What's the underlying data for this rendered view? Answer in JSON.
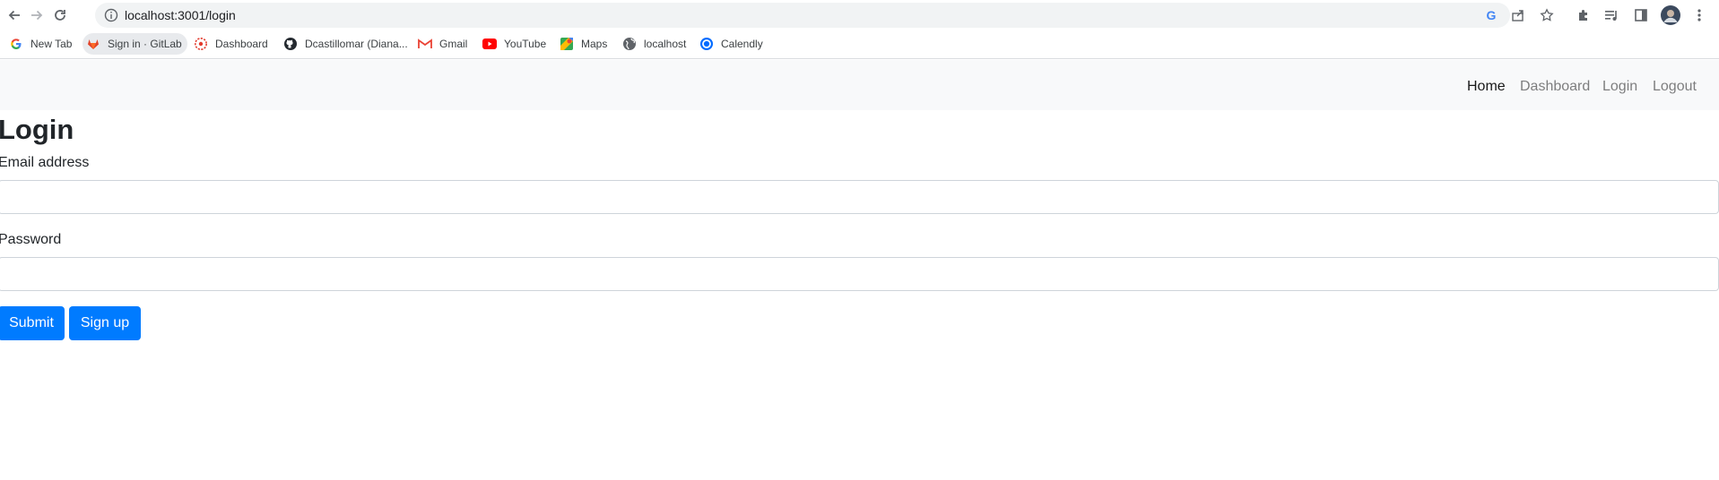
{
  "browser": {
    "url": "localhost:3001/login",
    "bookmarks": [
      {
        "label": "New Tab",
        "icon": "google-icon"
      },
      {
        "label": "Sign in · GitLab",
        "icon": "gitlab-icon"
      },
      {
        "label": "Dashboard",
        "icon": "dashboard-icon"
      },
      {
        "label": "Dcastillomar (Diana...",
        "icon": "github-icon"
      },
      {
        "label": "Gmail",
        "icon": "gmail-icon"
      },
      {
        "label": "YouTube",
        "icon": "youtube-icon"
      },
      {
        "label": "Maps",
        "icon": "maps-icon"
      },
      {
        "label": "localhost",
        "icon": "globe-icon"
      },
      {
        "label": "Calendly",
        "icon": "calendly-icon"
      }
    ]
  },
  "navbar": {
    "links": [
      {
        "label": "Home",
        "active": true
      },
      {
        "label": "Dashboard",
        "active": false
      },
      {
        "label": "Login",
        "active": false
      },
      {
        "label": "Logout",
        "active": false
      }
    ]
  },
  "form": {
    "title": "Login",
    "email_label": "Email address",
    "email_value": "",
    "password_label": "Password",
    "password_value": "",
    "submit_label": "Submit",
    "signup_label": "Sign up"
  },
  "colors": {
    "primary": "#007bff",
    "navbar_bg": "#f8f9fa",
    "omnibox_bg": "#f1f3f4"
  }
}
